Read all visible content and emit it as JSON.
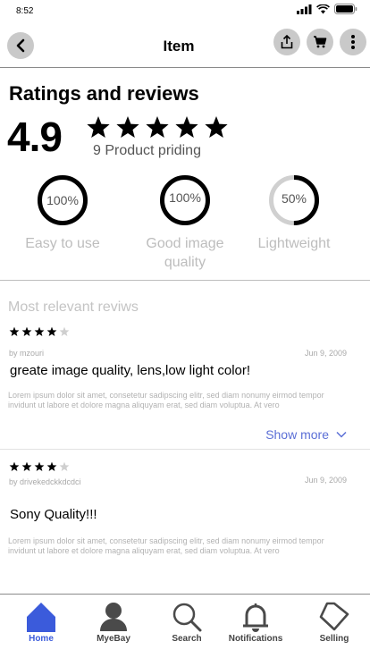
{
  "status_bar": {
    "time": "8:52"
  },
  "header": {
    "title": "Item"
  },
  "ratings": {
    "heading": "Ratings and reviews",
    "score": "4.9",
    "stars": 5,
    "count_text": "9 Product priding",
    "metrics": [
      {
        "percent_text": "100%",
        "fraction": 1.0,
        "label": "Easy to use"
      },
      {
        "percent_text": "100%",
        "fraction": 1.0,
        "label": "Good image quality"
      },
      {
        "percent_text": "50%",
        "fraction": 0.5,
        "label": "Lightweight"
      }
    ]
  },
  "reviews_section": {
    "heading": "Most relevant reviws"
  },
  "reviews": [
    {
      "stars": 4,
      "author": "by mzouri",
      "date": "Jun 9, 2009",
      "title": "greate image quality, lens,low light color!",
      "body": "Lorem ipsum dolor sit amet, consetetur sadipscing elitr, sed diam nonumy eirmod tempor invidunt ut labore et dolore magna aliquyam erat, sed diam voluptua. At vero",
      "show_more": "Show more"
    },
    {
      "stars": 4,
      "author": "by drivekedckkdcdci",
      "date": "Jun 9, 2009",
      "title": "Sony Quality!!!",
      "body": "Lorem ipsum dolor sit amet, consetetur sadipscing elitr, sed diam nonumy eirmod tempor invidunt ut labore et dolore magna aliquyam erat, sed diam voluptua. At vero"
    }
  ],
  "bottom_nav": {
    "items": [
      {
        "label": "Home",
        "icon": "home-icon",
        "active": true
      },
      {
        "label": "MyeBay",
        "icon": "person-icon",
        "active": false
      },
      {
        "label": "Search",
        "icon": "search-icon",
        "active": false
      },
      {
        "label": "Notifications",
        "icon": "bell-icon",
        "active": false
      },
      {
        "label": "Selling",
        "icon": "tag-icon",
        "active": false
      }
    ]
  },
  "colors": {
    "accent": "#3b5bdb",
    "link": "#5b6fd6",
    "icon_button_bg": "#c9c9c9"
  }
}
